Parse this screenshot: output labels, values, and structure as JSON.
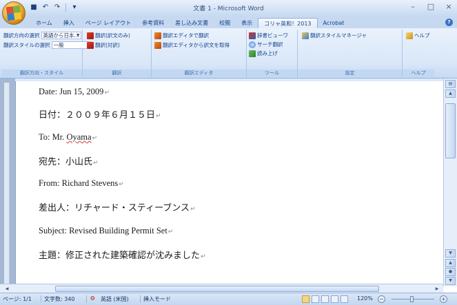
{
  "window": {
    "title": "文書 1 - Microsoft Word",
    "minimize": "–",
    "maximize": "□",
    "close": "×"
  },
  "quick_access": {
    "icons": [
      "save-icon",
      "undo-icon",
      "redo-icon",
      "customize-icon"
    ],
    "undo_symbol": "↶",
    "redo_symbol": "↷",
    "save_symbol": "■",
    "more_symbol": "▾"
  },
  "tabs": [
    "ホーム",
    "挿入",
    "ページ レイアウト",
    "参考資料",
    "差し込み文書",
    "校閲",
    "表示",
    "コリャ英和！2013",
    "Acrobat"
  ],
  "active_tab_index": 7,
  "ribbon": {
    "groups": [
      {
        "label": "翻訳方向・スタイル",
        "rows": [
          {
            "text": "翻訳方向の選択",
            "dropdown": "英語から日本..."
          },
          {
            "text": "翻訳スタイルの選択",
            "dropdown": "一般"
          }
        ]
      },
      {
        "label": "翻訳",
        "items": [
          "翻訳(訳文のみ)",
          "翻訳(対訳)"
        ]
      },
      {
        "label": "翻訳エディタ",
        "items": [
          "翻訳エディタで翻訳",
          "翻訳エディタから訳文を取得"
        ]
      },
      {
        "label": "ツール",
        "items": [
          "辞書ビューワ",
          "サーチ翻訳",
          "読み上げ"
        ]
      },
      {
        "label": "設定",
        "items": [
          "翻訳スタイルマネージャ"
        ]
      },
      {
        "label": "ヘルプ",
        "items": [
          "ヘルプ"
        ]
      }
    ]
  },
  "document": {
    "lines": [
      {
        "text": "Date: Jun 15, 2009",
        "lang": "en"
      },
      {
        "text": "日付：２００９年６月１５日",
        "lang": "jp"
      },
      {
        "text": "To: Mr. ",
        "extra": "Oyama",
        "lang": "en"
      },
      {
        "text": "宛先：小山氏",
        "lang": "jp"
      },
      {
        "text": "From: Richard Stevens",
        "lang": "en"
      },
      {
        "text": "差出人：リチャード・スティーブンス",
        "lang": "jp"
      },
      {
        "text": "Subject: Revised Building Permit Set",
        "lang": "en"
      },
      {
        "text": "主題：修正された建築確認が沈みました",
        "lang": "jp"
      }
    ],
    "paragraph_mark": "↵"
  },
  "status_bar": {
    "page": "ページ: 1/1",
    "word_count": "文字数: 340",
    "language": "英語 (米国)",
    "mode": "挿入モード",
    "zoom": "120%",
    "zoom_out": "−",
    "zoom_in": "+"
  },
  "colors": {
    "ribbon_text": "#15428b",
    "accent": "#3a72c4"
  }
}
